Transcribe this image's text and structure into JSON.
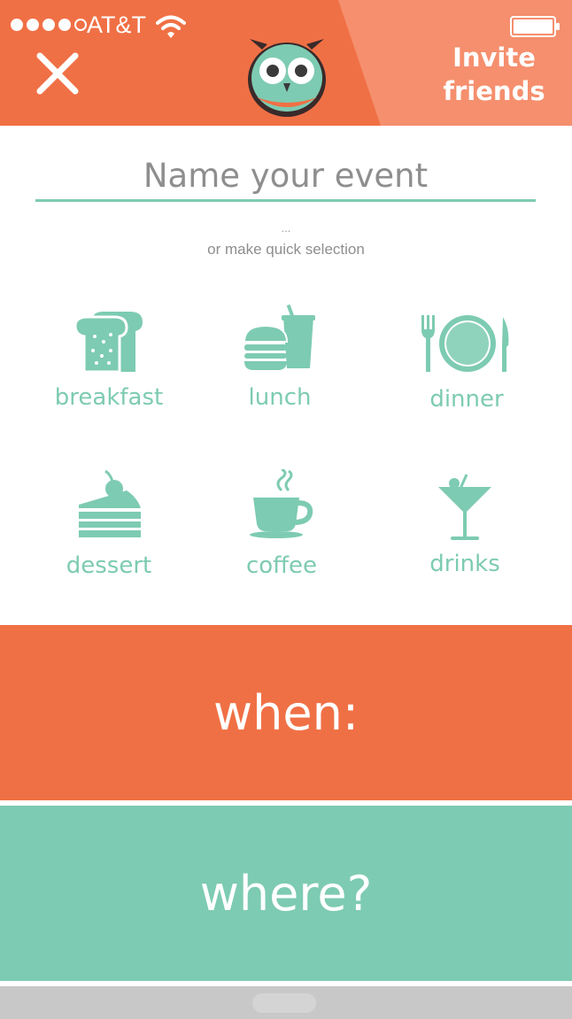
{
  "status_bar": {
    "carrier": "AT&T",
    "signal_bars_filled": 4,
    "signal_bars_total": 5
  },
  "header": {
    "close_icon": "x-icon",
    "logo_icon": "owl-icon",
    "invite_label_line1": "Invite",
    "invite_label_line2": "friends"
  },
  "event": {
    "name_placeholder": "Name your event",
    "name_value": "",
    "separator": "...",
    "quick_selection_label": "or make quick selection"
  },
  "quick_options": [
    {
      "label": "breakfast",
      "icon": "toast-icon"
    },
    {
      "label": "lunch",
      "icon": "burger-drink-icon"
    },
    {
      "label": "dinner",
      "icon": "plate-cutlery-icon"
    },
    {
      "label": "dessert",
      "icon": "cake-slice-icon"
    },
    {
      "label": "coffee",
      "icon": "coffee-cup-icon"
    },
    {
      "label": "drinks",
      "icon": "cocktail-icon"
    }
  ],
  "sections": {
    "when_label": "when:",
    "where_label": "where?"
  },
  "colors": {
    "accent_orange": "#f07045",
    "accent_orange_light": "#f58f6e",
    "accent_teal": "#7dcbb2",
    "text_gray": "#8e8e8e"
  }
}
